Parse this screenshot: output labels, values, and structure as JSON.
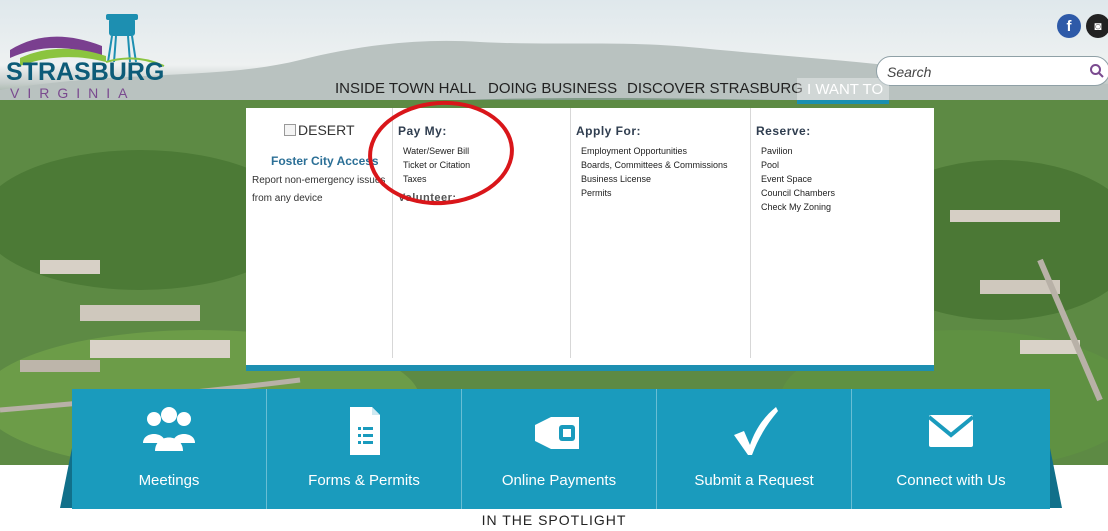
{
  "site": {
    "logo_title": "STRASBURG",
    "logo_subtitle": "VIRGINIA"
  },
  "social": {
    "facebook_glyph": "f",
    "instagram_glyph": "◙"
  },
  "search": {
    "placeholder": "Search"
  },
  "nav": {
    "items": [
      {
        "label": "INSIDE TOWN HALL"
      },
      {
        "label": "DOING BUSINESS"
      },
      {
        "label": "DISCOVER STRASBURG"
      },
      {
        "label": "I WANT TO"
      }
    ],
    "active_index": 3
  },
  "menu": {
    "featured": {
      "image_alt": "DESERT",
      "title": "Foster City Access",
      "description": "Report non-emergency issues from any device"
    },
    "pay": {
      "heading": "Pay My:",
      "items": [
        "Water/Sewer Bill",
        "Ticket or Citation",
        "Taxes"
      ],
      "volunteer": "Volunteer:"
    },
    "apply": {
      "heading": "Apply For:",
      "items": [
        "Employment Opportunities",
        "Boards, Committees & Commissions",
        "Business License",
        "Permits"
      ]
    },
    "reserve": {
      "heading": "Reserve:",
      "items": [
        "Pavilion",
        "Pool",
        "Event Space",
        "Council Chambers",
        "Check My Zoning"
      ]
    }
  },
  "quick_links": [
    {
      "label": "Meetings",
      "icon": "people-icon"
    },
    {
      "label": "Forms & Permits",
      "icon": "document-icon"
    },
    {
      "label": "Online Payments",
      "icon": "payment-icon"
    },
    {
      "label": "Submit a Request",
      "icon": "checkmark-icon"
    },
    {
      "label": "Connect with Us",
      "icon": "envelope-icon"
    }
  ],
  "spotlight": {
    "heading": "IN THE SPOTLIGHT"
  },
  "colors": {
    "accent": "#1a9bbd",
    "annotation_circle": "#d9161a",
    "brand_text": "#0d5b78"
  }
}
